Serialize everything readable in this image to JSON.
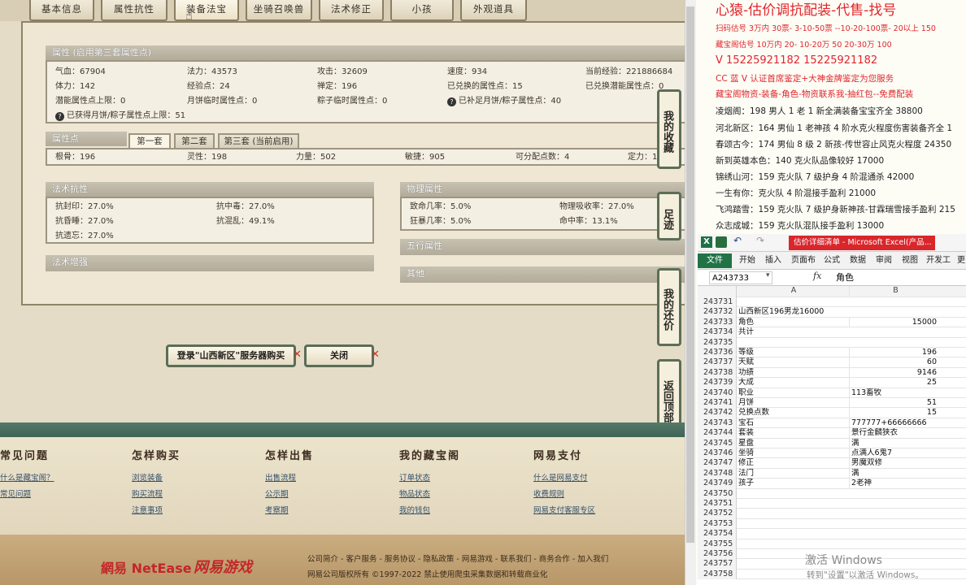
{
  "tabs": [
    "基本信息",
    "属性抗性",
    "装备法宝",
    "坐骑召唤兽",
    "法术修正",
    "小孩",
    "外观道具"
  ],
  "attr": {
    "title": "属性 (启用第三套属性点)",
    "rows": [
      [
        "气血：67904",
        "法力：43573",
        "攻击：32609",
        "速度：934",
        "当前经验：221886684"
      ],
      [
        "体力：142",
        "经验点：24",
        "禅定：196",
        "已兑换的属性点：15",
        "已兑换潜能属性点：0"
      ],
      [
        "潜能属性点上限：0",
        "月饼临时属性点：0",
        "粽子临时属性点：0",
        "已补足月饼/粽子属性点：40"
      ],
      [
        "已获得月饼/粽子属性点上限：51"
      ]
    ]
  },
  "points": {
    "title": "属性点",
    "tabs": [
      "第一套",
      "第二套",
      "第三套 (当前启用)"
    ],
    "row": [
      "根骨：196",
      "灵性：198",
      "力量：502",
      "敏捷：905",
      "可分配点数：4",
      "定力：1"
    ]
  },
  "resist": {
    "title": "法术抗性",
    "rows": [
      [
        "抗封印：27.0%",
        "抗中毒：27.0%"
      ],
      [
        "抗昏睡：27.0%",
        "抗混乱：49.1%"
      ],
      [
        "抗遗忘：27.0%"
      ]
    ]
  },
  "phys": {
    "title": "物理属性",
    "rows": [
      [
        "致命几率：5.0%",
        "物理吸收率：27.0%"
      ],
      [
        "狂暴几率：5.0%",
        "命中率：13.1%"
      ]
    ]
  },
  "wuxing": "五行属性",
  "other": "其他",
  "fashu": "法术增强",
  "side_buttons": [
    "我的收藏",
    "足迹",
    "我的还价",
    "返回顶部"
  ],
  "buy_button": "登录\"山西新区\"服务器购买",
  "close_button": "关闭",
  "help_columns": [
    {
      "title": "常见问题",
      "links": [
        "什么是藏宝阁？",
        "常见问题"
      ]
    },
    {
      "title": "怎样购买",
      "links": [
        "浏览装备",
        "购买流程",
        "注意事项"
      ]
    },
    {
      "title": "怎样出售",
      "links": [
        "出售流程",
        "公示期",
        "考察期"
      ]
    },
    {
      "title": "我的藏宝阁",
      "links": [
        "订单状态",
        "物品状态",
        "我的钱包"
      ]
    },
    {
      "title": "网易支付",
      "links": [
        "什么是网易支付",
        "收费规则",
        "网易支付客服专区"
      ]
    }
  ],
  "footer": {
    "logo1": "網易 NetEase",
    "logo2": "网易游戏",
    "links": "公司简介 - 客户服务 - 服务协议 - 隐私政策 - 网易游戏 - 联系我们 - 商务合作 - 加入我们",
    "copyright": "网易公司版权所有 ©1997-2022 禁止使用爬虫采集数据和转载商业化"
  },
  "ad": {
    "header": "心猿-估价调抗配装-代售-找号",
    "lines": [
      "扫码估号 3万内 30票- 3-10-50票 --10-20-100票- 20以上 150",
      "藏宝阁估号 10万内 20- 10-20万 50 20-30万 100",
      "V 15225921182   15225921182",
      "CC 蓝 V 认证首席鉴定+大神金牌鉴定为您服务",
      "藏宝阁物资-装备-角色-物资联系我-抽红包--免费配装",
      "凌烟阁：198 男人 1 老 1 新全满装备宝宝齐全 38800",
      "河北新区：164 男仙 1 老神孩 4 阶水克火程度伤害装备齐全 1",
      "春颂古今：174 男仙 8 级 2 新孩-传世容止风克火程度 24350",
      "新到英雄本色：140 克火队品像较好 17000",
      "锦绣山河：159 克火队 7 级护身 4 阶混通杀 42000",
      "一生有你：克火队 4 阶混接手盈利 21000",
      "飞鸿踏雪：159 克火队 7 级护身新神孩-甘霖瑞雪接手盈利 215",
      "众志成城：159 克火队混队接手盈利 13000"
    ]
  },
  "excel": {
    "title": "估价详细清单 - Microsoft Excel(产品...",
    "ribbon": [
      "文件",
      "开始",
      "插入",
      "页面布",
      "公式",
      "数据",
      "审阅",
      "视图",
      "开发工",
      "更多"
    ],
    "namebox": "A243733",
    "formula": "角色",
    "col_a": "A",
    "col_b": "B",
    "rows": [
      [
        "243731",
        "",
        ""
      ],
      [
        "243732",
        "山西新区196男龙16000",
        ""
      ],
      [
        "243733",
        "角色",
        "15000"
      ],
      [
        "243734",
        "共计",
        ""
      ],
      [
        "243735",
        "",
        ""
      ],
      [
        "243736",
        "等级",
        "196"
      ],
      [
        "243737",
        "天赋",
        "60"
      ],
      [
        "243738",
        "功绩",
        "9146"
      ],
      [
        "243739",
        "大成",
        "25"
      ],
      [
        "243740",
        "职业",
        "113畜牧"
      ],
      [
        "243741",
        "月饼",
        "51"
      ],
      [
        "243742",
        "兑换点数",
        "15"
      ],
      [
        "243743",
        "宝石",
        "777777+66666666"
      ],
      [
        "243744",
        "套装",
        "景行金麟狭衣"
      ],
      [
        "243745",
        "星盘",
        "满"
      ],
      [
        "243746",
        "坐骑",
        "点满人6鬼7"
      ],
      [
        "243747",
        "修正",
        "男魔双修"
      ],
      [
        "243748",
        "法门",
        "满"
      ],
      [
        "243749",
        "孩子",
        "2老神"
      ],
      [
        "243750",
        "",
        ""
      ],
      [
        "243751",
        "",
        ""
      ],
      [
        "243752",
        "",
        ""
      ],
      [
        "243753",
        "",
        ""
      ],
      [
        "243754",
        "",
        ""
      ],
      [
        "243755",
        "",
        ""
      ],
      [
        "243756",
        "",
        ""
      ],
      [
        "243757",
        "",
        ""
      ],
      [
        "243758",
        "",
        ""
      ]
    ],
    "numeric_rows": [
      2,
      5,
      6,
      7,
      8,
      10,
      11
    ]
  },
  "watermark": {
    "line1": "激活 Windows",
    "line2": "转到\"设置\"以激活 Windows。"
  }
}
